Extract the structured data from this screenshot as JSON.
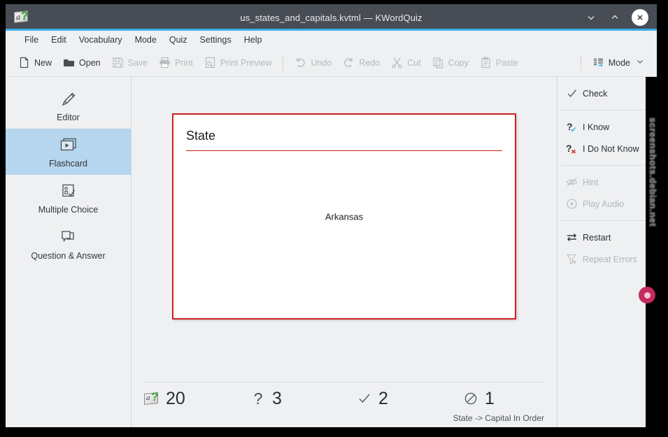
{
  "window": {
    "title": "us_states_and_capitals.kvtml — KWordQuiz",
    "app_icon": "kwordquiz-card-icon",
    "controls": {
      "minimize": "minimize-icon",
      "maximize": "maximize-icon",
      "close": "close-icon"
    }
  },
  "menubar": {
    "items": [
      {
        "label": "File"
      },
      {
        "label": "Edit"
      },
      {
        "label": "Vocabulary"
      },
      {
        "label": "Mode"
      },
      {
        "label": "Quiz"
      },
      {
        "label": "Settings"
      },
      {
        "label": "Help"
      }
    ]
  },
  "toolbar": {
    "groups": [
      [
        {
          "label": "New",
          "icon": "new-document-icon",
          "enabled": true
        },
        {
          "label": "Open",
          "icon": "folder-open-icon",
          "enabled": true
        },
        {
          "label": "Save",
          "icon": "floppy-disk-icon",
          "enabled": false
        },
        {
          "label": "Print",
          "icon": "printer-icon",
          "enabled": false
        },
        {
          "label": "Print Preview",
          "icon": "print-preview-icon",
          "enabled": false
        }
      ],
      [
        {
          "label": "Undo",
          "icon": "undo-arrow-icon",
          "enabled": false
        },
        {
          "label": "Redo",
          "icon": "redo-arrow-icon",
          "enabled": false
        },
        {
          "label": "Cut",
          "icon": "scissors-icon",
          "enabled": false
        },
        {
          "label": "Copy",
          "icon": "copy-icon",
          "enabled": false
        },
        {
          "label": "Paste",
          "icon": "clipboard-paste-icon",
          "enabled": false
        }
      ],
      [
        {
          "label": "Mode",
          "icon": "mode-list-icon",
          "enabled": true,
          "has_dropdown": true
        }
      ]
    ]
  },
  "sidebar": {
    "items": [
      {
        "label": "Editor",
        "icon": "pencil-icon",
        "active": false
      },
      {
        "label": "Flashcard",
        "icon": "flashcard-stack-icon",
        "active": true
      },
      {
        "label": "Multiple Choice",
        "icon": "checklist-icon",
        "active": false
      },
      {
        "label": "Question & Answer",
        "icon": "speech-bubbles-icon",
        "active": false
      }
    ]
  },
  "flashcard": {
    "heading": "State",
    "front_text": "Arkansas",
    "border_color": "#c9211e"
  },
  "scorebar": {
    "cells": [
      {
        "icon": "kwordquiz-card-icon",
        "value": "20",
        "meaning": "total-questions"
      },
      {
        "icon": "question-mark-icon",
        "value": "3",
        "meaning": "questions-asked"
      },
      {
        "icon": "checkmark-icon",
        "value": "2",
        "meaning": "correct-answers"
      },
      {
        "icon": "no-entry-icon",
        "value": "1",
        "meaning": "incorrect-answers"
      }
    ]
  },
  "statusline": {
    "text": "State -> Capital In Order"
  },
  "rightpanel": {
    "groups": [
      {
        "items": [
          {
            "label": "Check",
            "icon": "checkmark-icon",
            "enabled": true
          }
        ]
      },
      {
        "items": [
          {
            "label": "I Know",
            "icon": "question-check-icon",
            "enabled": true
          },
          {
            "label": "I Do Not Know",
            "icon": "question-cross-icon",
            "enabled": true
          }
        ]
      },
      {
        "items": [
          {
            "label": "Hint",
            "icon": "hint-eye-icon",
            "enabled": false
          },
          {
            "label": "Play Audio",
            "icon": "play-circle-icon",
            "enabled": false
          }
        ]
      },
      {
        "items": [
          {
            "label": "Restart",
            "icon": "restart-arrows-icon",
            "enabled": true
          },
          {
            "label": "Repeat Errors",
            "icon": "filter-error-icon",
            "enabled": false
          }
        ]
      }
    ]
  },
  "watermark": {
    "text": "screenshots.debian.net"
  },
  "colors": {
    "titlebar": "#474c55",
    "accent": "#3daee9",
    "selection": "#b5d6ee",
    "card_border": "#c9211e",
    "background": "#eff0f1"
  }
}
